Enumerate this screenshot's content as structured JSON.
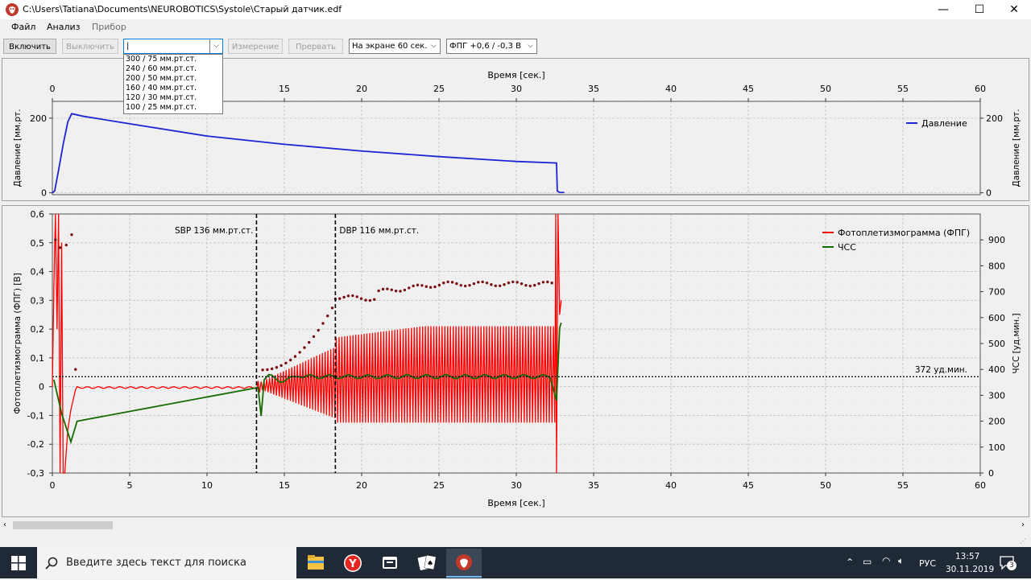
{
  "window": {
    "title": "C:\\Users\\Tatiana\\Documents\\NEUROBOTICS\\Systole\\Старый датчик.edf",
    "minimize": "—",
    "maximize": "☐",
    "close": "✕"
  },
  "menu": [
    "Файл",
    "Анализ",
    "Прибор"
  ],
  "toolbar": {
    "on_label": "Включить",
    "off_label": "Выключить",
    "cuff_value": "|",
    "cuff_options": [
      "300 / 75  мм.рт.ст.",
      "240 / 60  мм.рт.ст.",
      "200 / 50  мм.рт.ст.",
      "160 / 40  мм.рт.ст.",
      "120 / 30  мм.рт.ст.",
      "100 / 25  мм.рт.ст."
    ],
    "measure_label": "Измерение",
    "abort_label": "Прервать",
    "screen_value": "На экране 60 сек.",
    "ppg_range_value": "ФПГ +0,6 / -0,3  В"
  },
  "chart_data": [
    {
      "type": "line",
      "xlabel": "Время  [сек.]",
      "ylabel_left": "Давление [мм.рт.",
      "ylabel_right": "Давление [мм.рт.",
      "xlim": [
        0,
        60
      ],
      "ylim": [
        -5,
        245
      ],
      "x_ticks": [
        "0",
        "5",
        "10",
        "15",
        "20",
        "25",
        "30",
        "35",
        "40",
        "45",
        "50",
        "55",
        "60"
      ],
      "y_ticks": [
        "0",
        "200"
      ],
      "x_axis_position": "top",
      "grid": true,
      "legend_position": "top-right",
      "series": [
        {
          "name": "Давление",
          "color": "#1c24d4",
          "x": [
            0,
            0.15,
            0.4,
            0.7,
            1.0,
            1.25,
            2,
            5,
            10,
            15,
            20,
            25,
            30,
            32.6,
            32.65,
            32.8,
            33.1
          ],
          "y": [
            0,
            5,
            60,
            130,
            190,
            212,
            205,
            185,
            152,
            130,
            112,
            97,
            84,
            80,
            5,
            1,
            1
          ]
        }
      ]
    },
    {
      "type": "line",
      "xlabel": "Время  [сек.]",
      "ylabel_left": "Фотоплетизмограмма (ФПГ) [В]",
      "ylabel_right": "ЧСС [уд.мин.]",
      "xlim": [
        0,
        60
      ],
      "ylim_left": [
        -0.3,
        0.6
      ],
      "ylim_right": [
        0,
        1000
      ],
      "x_ticks": [
        "0",
        "5",
        "10",
        "15",
        "20",
        "25",
        "30",
        "35",
        "40",
        "45",
        "50",
        "55",
        "60"
      ],
      "y_ticks_left": [
        "0,6",
        "0,5",
        "0,4",
        "0,3",
        "0,2",
        "0,1",
        "0",
        "-0,1",
        "-0,2",
        "-0,3"
      ],
      "y_ticks_right": [
        "900",
        "800",
        "700",
        "600",
        "500",
        "400",
        "300",
        "200",
        "100",
        "0"
      ],
      "grid": true,
      "legend_position": "top-right",
      "series": [
        {
          "name": "Фотоплетизмограмма (ФПГ)",
          "color": "#ff0000"
        },
        {
          "name": "ЧСС",
          "color": "#156b00"
        }
      ],
      "markers": [
        {
          "label": "SBP  136 мм.рт.ст.",
          "x": 13.2
        },
        {
          "label": "DBP  116 мм.рт.ст.",
          "x": 18.3
        }
      ],
      "reference_line": {
        "label": "372 уд.мин.",
        "value": 372
      }
    }
  ],
  "taskbar": {
    "search_placeholder": "Введите здесь текст для поиска",
    "lang": "РУС",
    "time": "13:57",
    "date": "30.11.2019",
    "notifications": "3"
  }
}
